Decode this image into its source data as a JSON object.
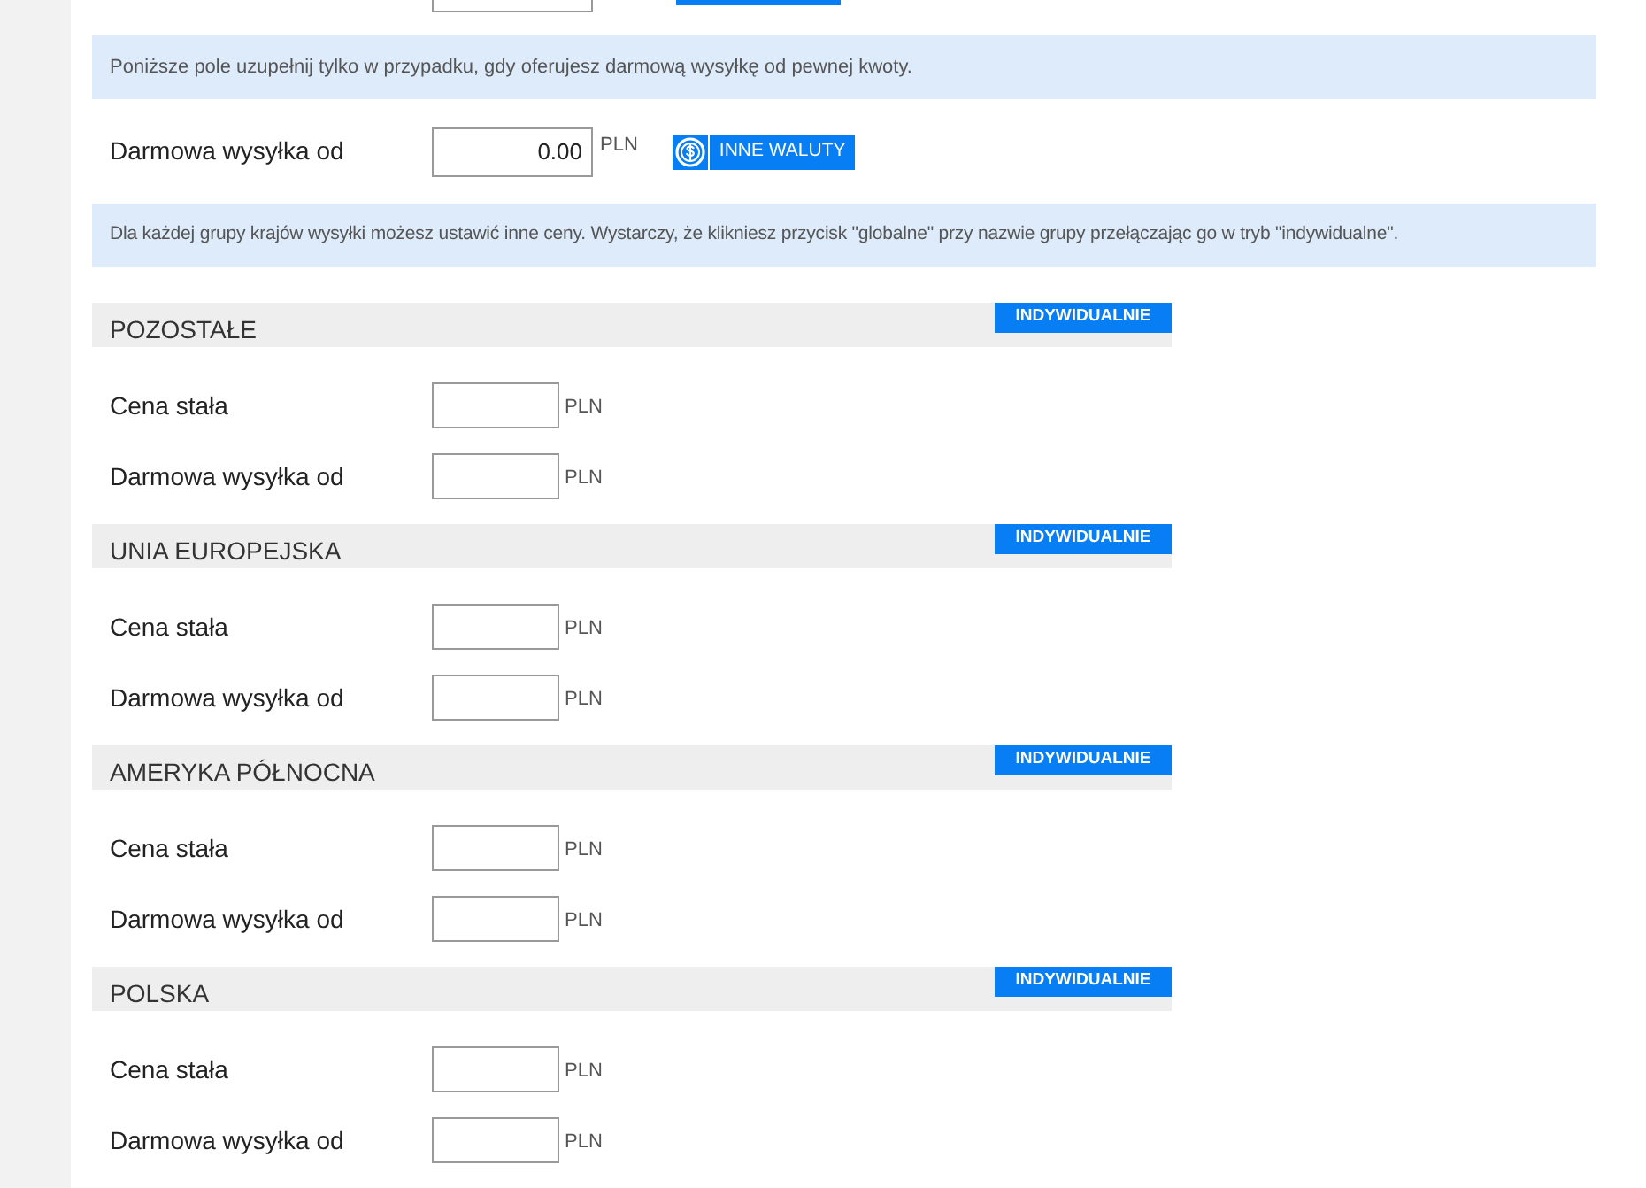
{
  "free_shipping_notice": "Poniższe pole uzupełnij tylko w przypadku, gdy oferujesz darmową wysyłkę od pewnej kwoty.",
  "free_shipping": {
    "label": "Darmowa wysyłka od",
    "value": "0.00",
    "currency": "PLN",
    "button": "INNE WALUTY"
  },
  "groups_notice": "Dla każdej grupy krajów wysyłki możesz ustawić inne ceny. Wystarczy, że klikniesz przycisk \"globalne\" przy nazwie grupy przełączając go w tryb \"indywidualne\".",
  "groups": [
    {
      "name": "POZOSTAŁE",
      "mode_button": "INDYWIDUALNIE",
      "fields": [
        {
          "label": "Cena stała",
          "currency": "PLN"
        },
        {
          "label": "Darmowa wysyłka od",
          "currency": "PLN"
        }
      ]
    },
    {
      "name": "UNIA EUROPEJSKA",
      "mode_button": "INDYWIDUALNIE",
      "fields": [
        {
          "label": "Cena stała",
          "currency": "PLN"
        },
        {
          "label": "Darmowa wysyłka od",
          "currency": "PLN"
        }
      ]
    },
    {
      "name": "AMERYKA PÓŁNOCNA",
      "mode_button": "INDYWIDUALNIE",
      "fields": [
        {
          "label": "Cena stała",
          "currency": "PLN"
        },
        {
          "label": "Darmowa wysyłka od",
          "currency": "PLN"
        }
      ]
    },
    {
      "name": "POLSKA",
      "mode_button": "INDYWIDUALNIE",
      "fields": [
        {
          "label": "Cena stała",
          "currency": "PLN"
        },
        {
          "label": "Darmowa wysyłka od",
          "currency": "PLN"
        }
      ]
    }
  ]
}
